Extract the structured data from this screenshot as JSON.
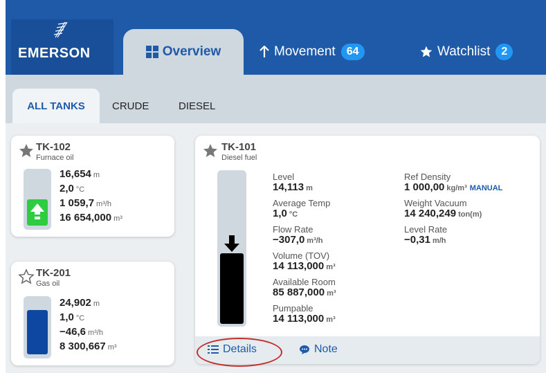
{
  "brand": {
    "logo_text": "EMERSON"
  },
  "nav": {
    "tabs": [
      {
        "label": "Overview",
        "icon": "grid-icon"
      },
      {
        "label": "Movement",
        "icon": "arrow-up-icon",
        "badge": "64"
      },
      {
        "label": "Watchlist",
        "icon": "star-icon",
        "badge": "2"
      }
    ]
  },
  "subtabs": [
    "ALL TANKS",
    "CRUDE",
    "DIESEL"
  ],
  "tanks": [
    {
      "id": "TK-102",
      "product": "Furnace oil",
      "starred": true,
      "level": "16,654",
      "level_unit": "m",
      "temp": "2,0",
      "temp_unit": "°C",
      "flow": "1 059,7",
      "flow_unit": "m³/h",
      "volume": "16 654,000",
      "volume_unit": "m³",
      "indicator": "arrow-up-icon"
    },
    {
      "id": "TK-201",
      "product": "Gas oil",
      "starred": false,
      "level": "24,902",
      "level_unit": "m",
      "temp": "1,0",
      "temp_unit": "°C",
      "flow": "−46,6",
      "flow_unit": "m³/h",
      "volume": "8 300,667",
      "volume_unit": "m³"
    }
  ],
  "detail": {
    "id": "TK-101",
    "product": "Diesel fuel",
    "left": [
      {
        "label": "Level",
        "value": "14,113",
        "unit": "m"
      },
      {
        "label": "Average Temp",
        "value": "1,0",
        "unit": "°C"
      },
      {
        "label": "Flow Rate",
        "value": "−307,0",
        "unit": "m³/h"
      },
      {
        "label": "Volume (TOV)",
        "value": "14 113,000",
        "unit": "m³"
      },
      {
        "label": "Available Room",
        "value": "85 887,000",
        "unit": "m³"
      },
      {
        "label": "Pumpable",
        "value": "14 113,000",
        "unit": "m³"
      }
    ],
    "right": [
      {
        "label": "Ref Density",
        "value": "1 000,00",
        "unit": "kg/m³",
        "tag": "MANUAL"
      },
      {
        "label": "Weight Vacuum",
        "value": "14 240,249",
        "unit": "ton(m)"
      },
      {
        "label": "Level Rate",
        "value": "−0,31",
        "unit": "m/h"
      }
    ],
    "footer": {
      "details_label": "Details",
      "note_label": "Note"
    }
  },
  "colors": {
    "brand_blue": "#1e5aa8",
    "badge_blue": "#2196f3",
    "up_green": "#2ecc40",
    "fill_blue": "#0d47a1",
    "fill_black": "#000000",
    "highlight_red": "#c0302c"
  }
}
